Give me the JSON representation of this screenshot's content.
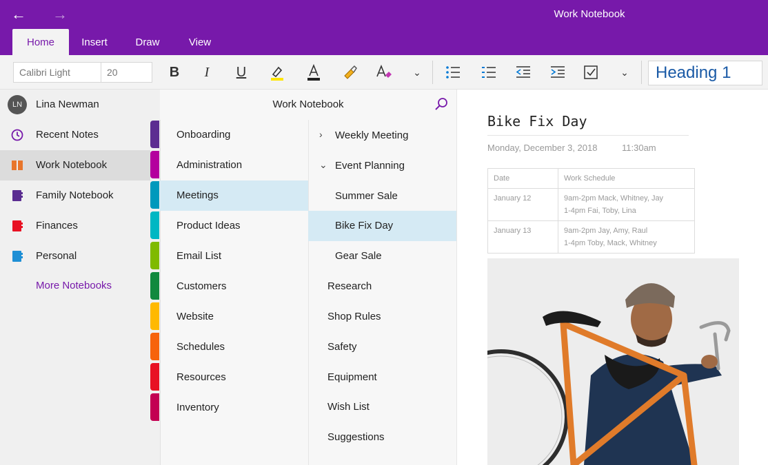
{
  "window": {
    "title": "Work Notebook"
  },
  "ribbon": {
    "tabs": [
      {
        "label": "Home",
        "active": true
      },
      {
        "label": "Insert",
        "active": false
      },
      {
        "label": "Draw",
        "active": false
      },
      {
        "label": "View",
        "active": false
      }
    ],
    "font_name": "Calibri Light",
    "font_size": "20",
    "style": "Heading 1",
    "accent_color": "#7719aa"
  },
  "sidebar": {
    "user": {
      "initials": "LN",
      "name": "Lina Newman"
    },
    "items": [
      {
        "label": "Recent Notes",
        "icon": "clock-icon",
        "color": "#7719aa"
      },
      {
        "label": "Work Notebook",
        "icon": "open-notebook-icon",
        "color": "#e8762c",
        "selected": true
      },
      {
        "label": "Family Notebook",
        "icon": "notebook-icon",
        "color": "#5a2d91"
      },
      {
        "label": "Finances",
        "icon": "notebook-icon",
        "color": "#e81123"
      },
      {
        "label": "Personal",
        "icon": "notebook-icon",
        "color": "#1e8fd5"
      }
    ],
    "more_label": "More Notebooks"
  },
  "sections": {
    "header": "Work Notebook",
    "items": [
      {
        "label": "Onboarding",
        "color": "#5c2d91"
      },
      {
        "label": "Administration",
        "color": "#b4009e"
      },
      {
        "label": "Meetings",
        "color": "#0099bc",
        "selected": true
      },
      {
        "label": "Product Ideas",
        "color": "#00b7c3"
      },
      {
        "label": "Email List",
        "color": "#7fba00"
      },
      {
        "label": "Customers",
        "color": "#10893e"
      },
      {
        "label": "Website",
        "color": "#ffb900"
      },
      {
        "label": "Schedules",
        "color": "#f7630c"
      },
      {
        "label": "Resources",
        "color": "#e81123"
      },
      {
        "label": "Inventory",
        "color": "#c30052"
      }
    ]
  },
  "pages": {
    "items": [
      {
        "label": "Weekly Meeting",
        "chevron": "chevron-right-icon"
      },
      {
        "label": "Event Planning",
        "chevron": "chevron-down-icon"
      },
      {
        "label": "Summer Sale",
        "subpage": true
      },
      {
        "label": "Bike Fix Day",
        "subpage": true,
        "selected": true
      },
      {
        "label": "Gear Sale",
        "subpage": true
      },
      {
        "label": "Research"
      },
      {
        "label": "Shop Rules"
      },
      {
        "label": "Safety"
      },
      {
        "label": "Equipment"
      },
      {
        "label": "Wish List"
      },
      {
        "label": "Suggestions"
      }
    ]
  },
  "page": {
    "title": "Bike Fix Day",
    "date": "Monday, December 3, 2018",
    "time": "11:30am",
    "table": {
      "headers": [
        "Date",
        "Work Schedule"
      ],
      "rows": [
        {
          "date": "January 12",
          "line1": "9am-2pm Mack, Whitney, Jay",
          "line2": "1-4pm Fai, Toby, Lina"
        },
        {
          "date": "January 13",
          "line1": "9am-2pm Jay, Amy, Raul",
          "line2": "1-4pm Toby, Mack, Whitney"
        }
      ]
    }
  }
}
